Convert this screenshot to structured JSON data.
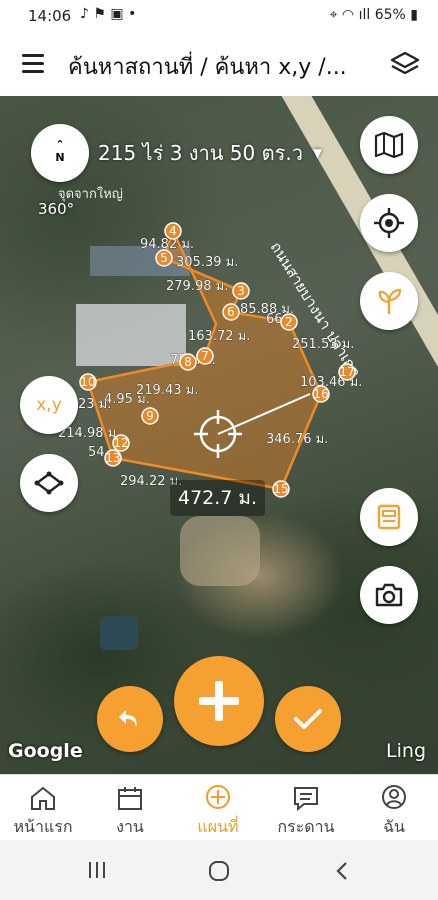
{
  "status_bar": {
    "time": "14:06",
    "battery": "65%"
  },
  "app_bar": {
    "title": "ค้นหาสถานที่ / ค้นหา x,y /..."
  },
  "map": {
    "area_label": "215 ไร่ 3 งาน 50 ตร.ว",
    "rotation": "360°",
    "road_label_1": "ถนนสายบางนา ปลาเกต",
    "road_label_2": "จุดจากใหญ่",
    "center_distance": "472.7 ม.",
    "points": [
      "2",
      "3",
      "4",
      "5",
      "6",
      "7",
      "8",
      "9",
      "10",
      "12",
      "13",
      "15",
      "16",
      "17"
    ],
    "segment_labels": [
      "94.82 ม.",
      "305.39 ม.",
      "279.98 ม.",
      "85.88 ม.",
      "66.",
      "163.72 ม.",
      "251.53 ม.",
      "7817ม.",
      "219.43 ม.",
      "103.46 ม.",
      "23 ม.",
      "4.95 ม.",
      "214.98 ม.",
      "54",
      "346.76 ม.",
      "294.22 ม."
    ],
    "xy_button_label": "x,y",
    "google_label": "Google",
    "ling_label": "Ling"
  },
  "bottom_nav": {
    "items": [
      {
        "label": "หน้าแรก",
        "icon": "home-icon"
      },
      {
        "label": "งาน",
        "icon": "calendar-icon"
      },
      {
        "label": "แผนที่",
        "icon": "map-plus-icon"
      },
      {
        "label": "กระดาน",
        "icon": "board-icon"
      },
      {
        "label": "ฉัน",
        "icon": "profile-icon"
      }
    ],
    "active": "แผนที่"
  },
  "colors": {
    "accent": "#f5a030",
    "polygon": "#e8892a"
  }
}
